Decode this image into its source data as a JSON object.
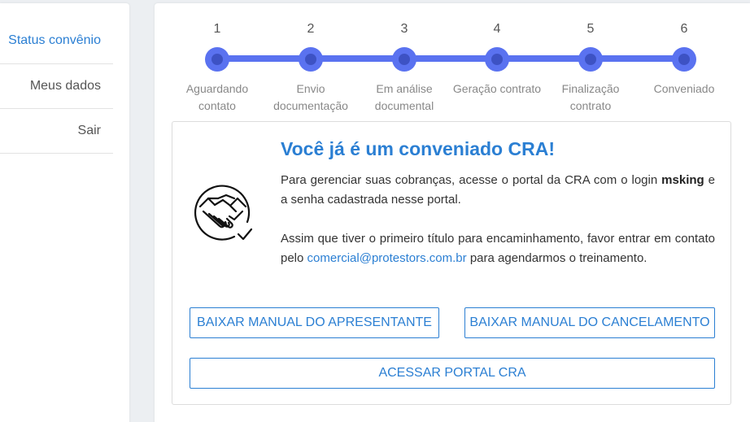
{
  "sidebar": {
    "items": [
      {
        "label": "Status convênio",
        "active": true
      },
      {
        "label": "Meus dados",
        "active": false
      },
      {
        "label": "Sair",
        "active": false
      }
    ]
  },
  "stepper": {
    "steps": [
      {
        "number": "1",
        "label_line1": "Aguardando",
        "label_line2": "contato"
      },
      {
        "number": "2",
        "label_line1": "Envio",
        "label_line2": "documentação"
      },
      {
        "number": "3",
        "label_line1": "Em análise",
        "label_line2": "documental"
      },
      {
        "number": "4",
        "label_line1": "Geração contrato",
        "label_line2": ""
      },
      {
        "number": "5",
        "label_line1": "Finalização",
        "label_line2": "contrato"
      },
      {
        "number": "6",
        "label_line1": "Conveniado",
        "label_line2": ""
      }
    ]
  },
  "panel": {
    "title": "Você já é um conveniado CRA!",
    "para1_before": "Para gerenciar suas cobranças, acesse o portal da CRA com o login ",
    "para1_login": "msking",
    "para1_after": " e a senha cadastrada nesse portal.",
    "para2_before": "Assim que tiver o primeiro título para encaminhamento, favor entrar em contato pelo ",
    "para2_email": "comercial@protestors.com.br",
    "para2_after": " para agendarmos o treinamento.",
    "icon": "handshake-icon"
  },
  "buttons": {
    "manual_apresentante": "BAIXAR MANUAL DO APRESENTANTE",
    "manual_cancelamento": "BAIXAR MANUAL DO CANCELAMENTO",
    "portal_cra": "ACESSAR PORTAL CRA"
  },
  "colors": {
    "accent": "#2b7fd3",
    "stepper": "#5a72f0",
    "stepper_inner": "#3d52c4",
    "background": "#eceff2"
  }
}
